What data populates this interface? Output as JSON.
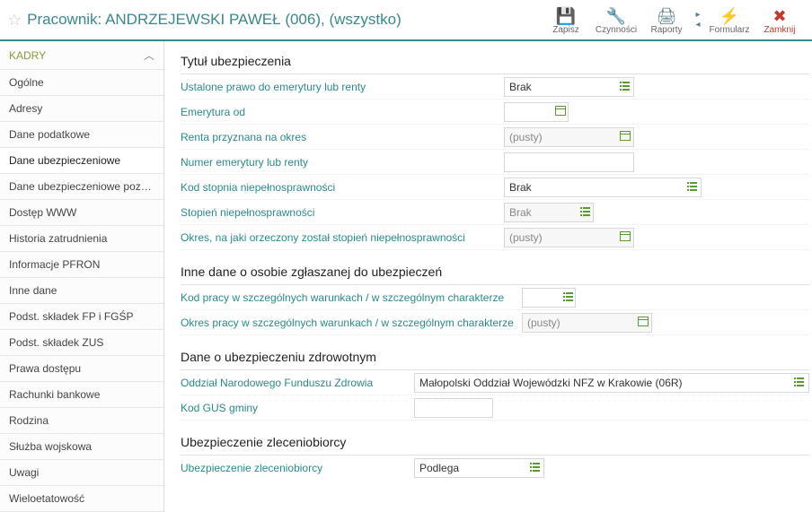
{
  "header": {
    "title": "Pracownik: ANDRZEJEWSKI PAWEŁ (006), (wszystko)",
    "buttons": {
      "save": "Zapisz",
      "actions": "Czynności",
      "reports": "Raporty",
      "form": "Formularz",
      "close": "Zamknij"
    }
  },
  "sidebar": {
    "head": "KADRY",
    "items": [
      "Ogólne",
      "Adresy",
      "Dane podatkowe",
      "Dane ubezpieczeniowe",
      "Dane ubezpieczeniowe pozos...",
      "Dostęp WWW",
      "Historia zatrudnienia",
      "Informacje PFRON",
      "Inne dane",
      "Podst. składek FP i FGŚP",
      "Podst. składek ZUS",
      "Prawa dostępu",
      "Rachunki bankowe",
      "Rodzina",
      "Służba wojskowa",
      "Uwagi",
      "Wieloetatowość"
    ],
    "active_index": 3
  },
  "sections": {
    "s1": {
      "title": "Tytuł ubezpieczenia",
      "rows": {
        "r1": {
          "label": "Ustalone prawo do emerytury lub renty",
          "value": "Brak"
        },
        "r2": {
          "label": "Emerytura od",
          "value": ""
        },
        "r3": {
          "label": "Renta przyznana na okres",
          "value": "(pusty)"
        },
        "r4": {
          "label": "Numer emerytury lub renty",
          "value": ""
        },
        "r5": {
          "label": "Kod stopnia niepełnosprawności",
          "value": "Brak"
        },
        "r6": {
          "label": "Stopień niepełnosprawności",
          "value": "Brak"
        },
        "r7": {
          "label": "Okres, na jaki orzeczony został stopień niepełnosprawności",
          "value": "(pusty)"
        }
      }
    },
    "s2": {
      "title": "Inne dane o osobie zgłaszanej do ubezpieczeń",
      "rows": {
        "r1": {
          "label": "Kod pracy w szczególnych warunkach / w szczególnym charakterze",
          "value": ""
        },
        "r2": {
          "label": "Okres pracy w szczególnych warunkach / w szczególnym charakterze",
          "value": "(pusty)"
        }
      }
    },
    "s3": {
      "title": "Dane o ubezpieczeniu zdrowotnym",
      "rows": {
        "r1": {
          "label": "Oddział Narodowego Funduszu Zdrowia",
          "value": "Małopolski Oddział Wojewódzki NFZ w Krakowie (06R)"
        },
        "r2": {
          "label": "Kod GUS gminy",
          "value": ""
        }
      }
    },
    "s4": {
      "title": "Ubezpieczenie zleceniobiorcy",
      "rows": {
        "r1": {
          "label": "Ubezpieczenie zleceniobiorcy",
          "value": "Podlega"
        }
      }
    }
  }
}
